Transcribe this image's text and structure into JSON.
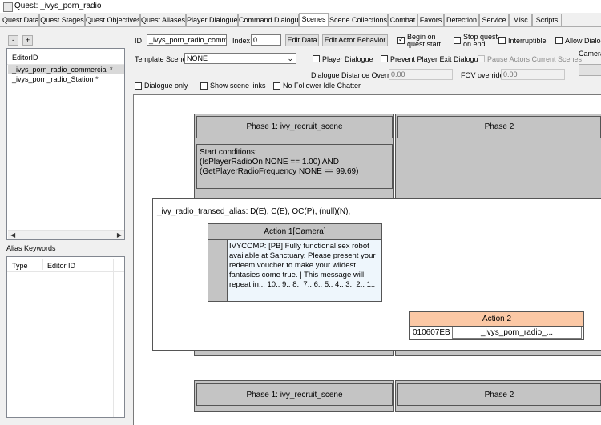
{
  "window": {
    "title": "Quest: _ivys_porn_radio"
  },
  "tabs": [
    {
      "label": "Quest Data"
    },
    {
      "label": "Quest Stages"
    },
    {
      "label": "Quest Objectives"
    },
    {
      "label": "Quest Aliases"
    },
    {
      "label": "Player Dialogue"
    },
    {
      "label": "Command Dialogue"
    },
    {
      "label": "Scenes",
      "active": true
    },
    {
      "label": "Scene Collections"
    },
    {
      "label": "Combat"
    },
    {
      "label": "Favors"
    },
    {
      "label": "Detection"
    },
    {
      "label": "Service"
    },
    {
      "label": "Misc"
    },
    {
      "label": "Scripts"
    }
  ],
  "left": {
    "minus_label": "-",
    "plus_label": "+",
    "editor_id_header": "EditorID",
    "scenes": [
      "_ivys_porn_radio_commercial *",
      "_ivys_porn_radio_Station *"
    ],
    "alias_keywords_label": "Alias Keywords",
    "alias_cols": [
      "Type",
      "Editor ID"
    ]
  },
  "form": {
    "id_label": "ID",
    "id_value": "_ivys_porn_radio_commercial",
    "index_label": "Index",
    "index_value": "0",
    "edit_data_label": "Edit Data",
    "edit_actor_behavior_label": "Edit Actor Behavior",
    "begin_on_start_label": "Begin on quest start",
    "stop_on_end_label": "Stop quest on end",
    "interruptible_label": "Interruptible",
    "allow_dialogue_label": "Allow Dialogue",
    "template_scene_label": "Template Scene",
    "template_scene_value": "NONE",
    "player_dialogue_label": "Player Dialogue",
    "prevent_exit_label": "Prevent Player Exit Dialogue",
    "pause_actors_label": "Pause Actors Current Scenes",
    "camera_label": "Camera",
    "dialogue_distance_label": "Dialogue Distance Override",
    "dialogue_distance_value": "0.00",
    "fov_label": "FOV override",
    "fov_value": "0.00",
    "dialogue_only_label": "Dialogue only",
    "show_links_label": "Show scene links",
    "no_follower_label": "No Follower Idle Chatter"
  },
  "canvas": {
    "phase1_title": "Phase 1: ivy_recruit_scene",
    "phase2_title": "Phase 2",
    "start_conditions": "Start conditions:\n(IsPlayerRadioOn NONE == 1.00) AND\n(GetPlayerRadioFrequency NONE == 99.69)",
    "alias_row": "_ivy_radio_transed_alias: D(E), C(E), OC(P), (null)(N),",
    "action1_title": "Action 1[Camera]",
    "action1_text": "IVYCOMP: [PB] Fully functional sex robot available at Sanctuary. Please present your redeem voucher to make your wildest fantasies come true. | This message will repeat in... 10.. 9.. 8.. 7.. 6.. 5.. 4.. 3.. 2.. 1..",
    "action2_title": "Action 2",
    "action2_formid": "010607EB",
    "action2_name": "_ivys_porn_radio_...",
    "bottom_phase1_title": "Phase 1: ivy_recruit_scene",
    "bottom_phase2_title": "Phase 2"
  },
  "colors": {
    "action2_header": "#fbc8a5",
    "action1_bg": "#eef6fc"
  }
}
